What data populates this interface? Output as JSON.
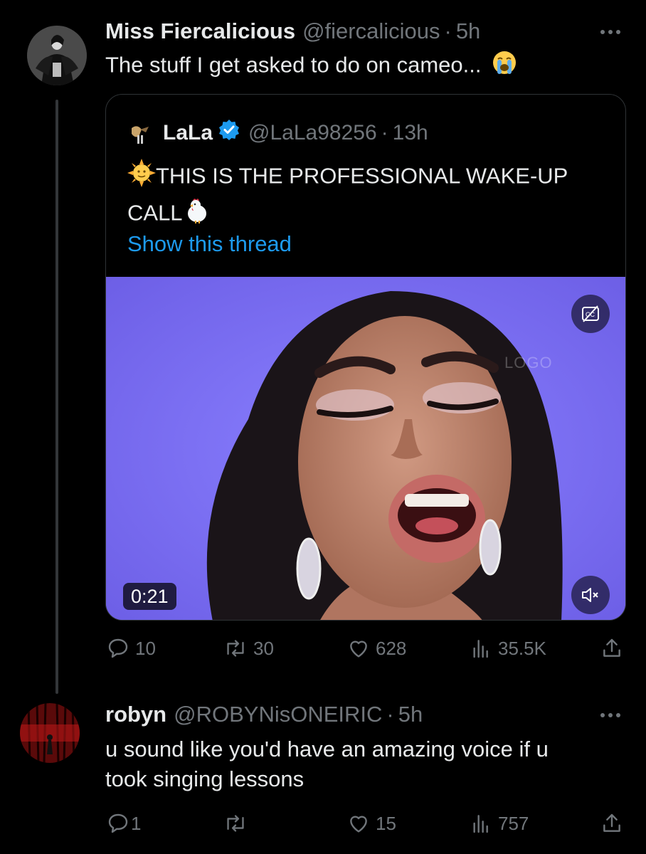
{
  "thread": {
    "tweet1": {
      "display_name": "Miss Fiercalicious",
      "handle": "@fiercalicious",
      "separator": "·",
      "time": "5h",
      "text": "The stuff I get asked to do on cameo...",
      "emoji": "loudly-crying-face",
      "quoted": {
        "display_name": "LaLa",
        "handle": "@LaLa98256",
        "separator": "·",
        "time": "13h",
        "text_line1": "THIS IS THE PROFESSIONAL WAKE-UP",
        "text_line2": "CALL",
        "leading_emoji": "sun-with-face",
        "trailing_emoji": "chicken",
        "show_thread": "Show this thread",
        "video": {
          "duration": "0:21",
          "watermark": "LOGO",
          "background_color": "#7a6cf0",
          "captions_icon": "captions-off-icon",
          "mute_icon": "speaker-muted-icon"
        }
      },
      "stats": {
        "replies": "10",
        "retweets": "30",
        "likes": "628",
        "views": "35.5K"
      }
    },
    "tweet2": {
      "display_name": "robyn",
      "handle": "@ROBYNisONEIRIC",
      "separator": "·",
      "time": "5h",
      "text_line1": "u sound like you'd have an amazing voice if u",
      "text_line2": "took singing lessons",
      "stats": {
        "replies": "1",
        "retweets": "",
        "likes": "15",
        "views": "757"
      }
    }
  },
  "colors": {
    "background": "#000000",
    "text_primary": "#e7e9ea",
    "text_secondary": "#71767b",
    "link": "#1d9bf0",
    "verified": "#1d9bf0",
    "border": "#2f3336"
  }
}
